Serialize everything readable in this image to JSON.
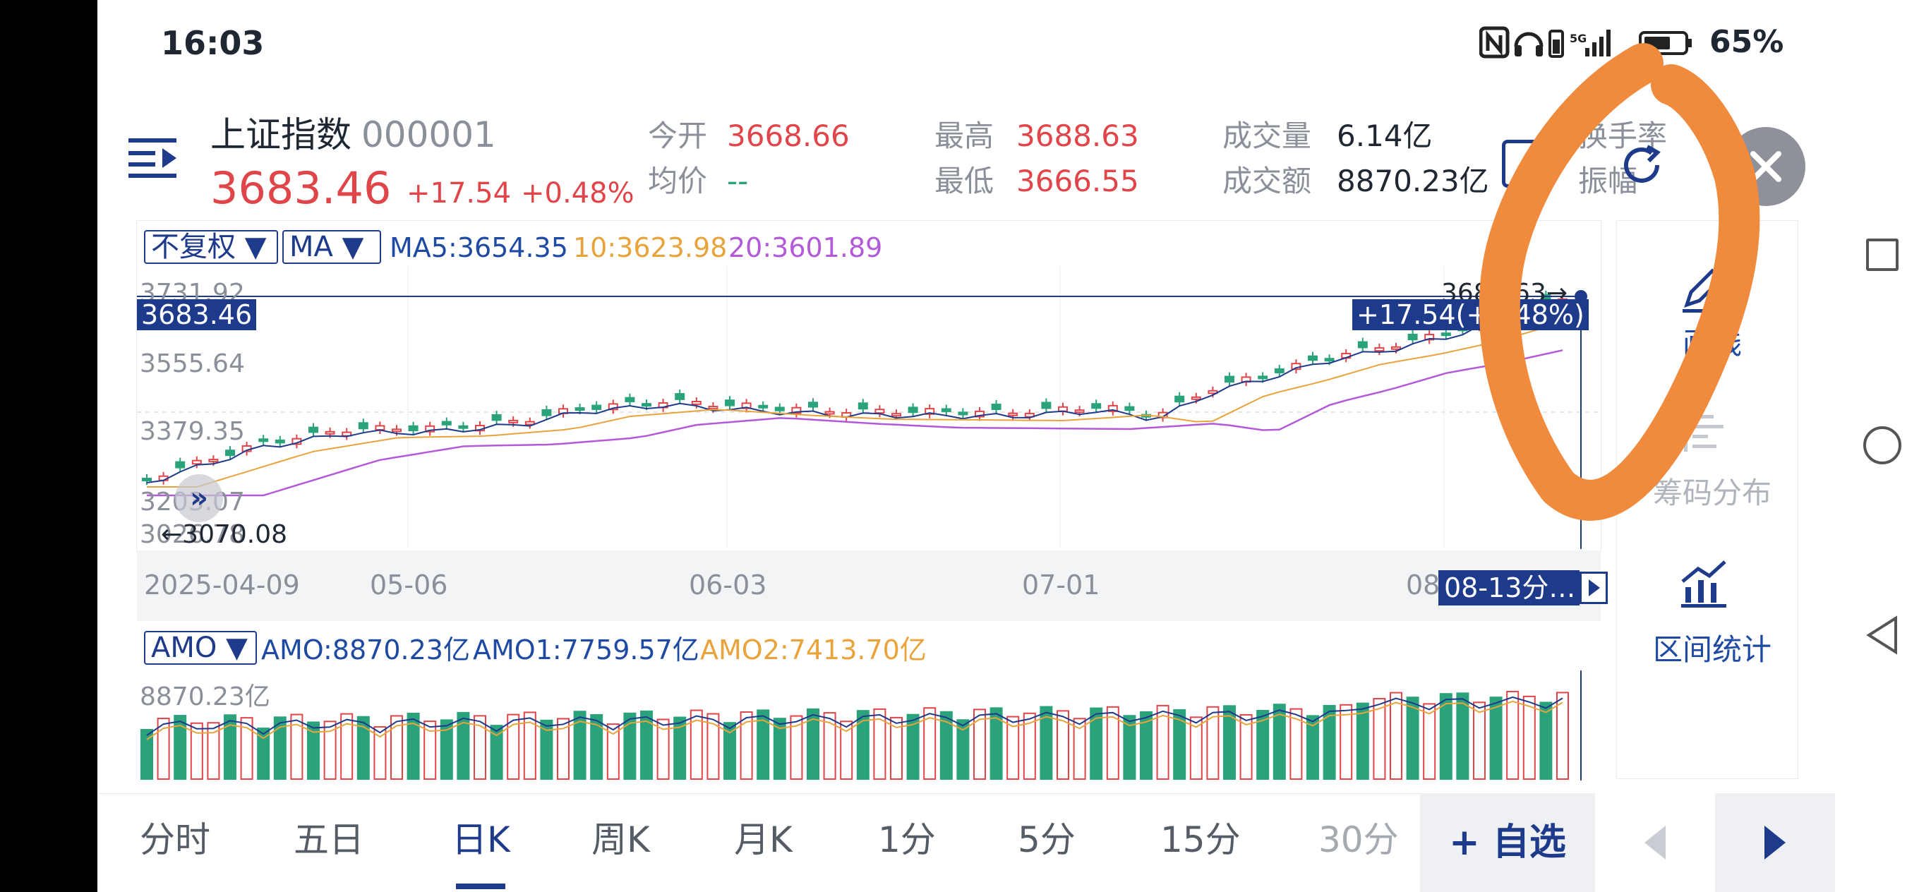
{
  "status_bar": {
    "time": "16:03",
    "net_label": "5G",
    "battery": "65%"
  },
  "header": {
    "name": "上证指数",
    "code": "000001",
    "price": "3683.46",
    "change": "+17.54",
    "change_pct": "+0.48%",
    "stats": {
      "open_label": "今开",
      "open_value": "3668.66",
      "avg_label": "均价",
      "avg_value": "--",
      "high_label": "最高",
      "high_value": "3688.63",
      "low_label": "最低",
      "low_value": "3666.55",
      "vol_label": "成交量",
      "vol_value": "6.14亿",
      "amt_label": "成交额",
      "amt_value": "8870.23亿",
      "turnover_label": "换手率",
      "amplitude_label": "振幅"
    }
  },
  "chart": {
    "adjust_select": "不复权 ▼",
    "indicator_select": "MA ▼",
    "ma5": "MA5:3654.35",
    "ma10": "10:3623.98",
    "ma20": "20:3601.89",
    "crosshair_price": "3683.46",
    "crosshair_change": "+17.54(+0.48%)",
    "y_labels": [
      "3731.92",
      "3555.64",
      "3379.35",
      "3203.07",
      "3026.78"
    ],
    "low_marker": "←3070.08",
    "high_marker": "3688.63→",
    "dates": [
      "2025-04-09",
      "05-06",
      "06-03",
      "07-01",
      "08"
    ],
    "date_tip": "08-13分…"
  },
  "volume": {
    "indicator_select": "AMO ▼",
    "amo": "AMO:8870.23亿",
    "amo1": "AMO1:7759.57亿",
    "amo2": "AMO2:7413.70亿",
    "y_label": "8870.23亿"
  },
  "side_panel": {
    "draw_label": "画线",
    "chips_label": "筹码分布",
    "range_label": "区间统计"
  },
  "bottom_tabs": [
    "分时",
    "五日",
    "日K",
    "周K",
    "月K",
    "1分",
    "5分",
    "15分",
    "30分"
  ],
  "active_tab": "日K",
  "watchlist_button": "+ 自选",
  "colors": {
    "up": "#e0454a",
    "down": "#2aa37d",
    "ma10": "#e8a33b",
    "ma20": "#b35ad8",
    "brand": "#1e3a8a",
    "annotation": "#f08a3c"
  }
}
